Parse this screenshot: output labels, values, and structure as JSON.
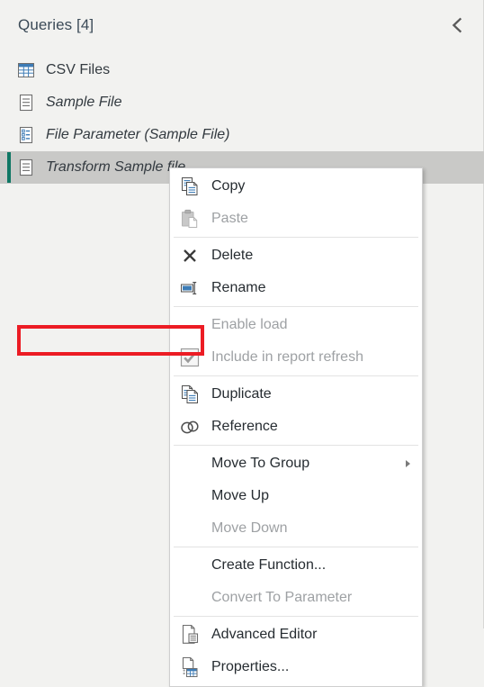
{
  "panel": {
    "title": "Queries [4]",
    "collapse_icon": "chevron-left-icon",
    "accent_color": "#0f7764",
    "selected_row_bg": "#c9c9c7",
    "background": "#f2f2f0"
  },
  "queries": [
    {
      "label": "CSV Files",
      "icon": "table-icon",
      "italic": false,
      "selected": false
    },
    {
      "label": "Sample File",
      "icon": "document-icon",
      "italic": true,
      "selected": false
    },
    {
      "label": "File Parameter (Sample File)",
      "icon": "parameter-icon",
      "italic": true,
      "selected": false
    },
    {
      "label": "Transform Sample file",
      "icon": "document-icon",
      "italic": true,
      "selected": true
    }
  ],
  "context_menu": {
    "groups": [
      {
        "items": [
          {
            "label": "Copy",
            "icon": "copy-icon",
            "disabled": false,
            "submenu": false,
            "highlighted": false
          },
          {
            "label": "Paste",
            "icon": "paste-icon",
            "disabled": true,
            "submenu": false,
            "highlighted": false
          }
        ]
      },
      {
        "items": [
          {
            "label": "Delete",
            "icon": "delete-x-icon",
            "disabled": false,
            "submenu": false,
            "highlighted": false
          },
          {
            "label": "Rename",
            "icon": "rename-icon",
            "disabled": false,
            "submenu": false,
            "highlighted": false
          }
        ]
      },
      {
        "items": [
          {
            "label": "Enable load",
            "icon": "none",
            "disabled": true,
            "submenu": false,
            "highlighted": false
          },
          {
            "label": "Include in report refresh",
            "icon": "checkbox-checked-icon",
            "disabled": true,
            "submenu": false,
            "highlighted": false
          }
        ]
      },
      {
        "items": [
          {
            "label": "Duplicate",
            "icon": "duplicate-icon",
            "disabled": false,
            "submenu": false,
            "highlighted": false
          },
          {
            "label": "Reference",
            "icon": "reference-link-icon",
            "disabled": false,
            "submenu": false,
            "highlighted": false
          }
        ]
      },
      {
        "items": [
          {
            "label": "Move To Group",
            "icon": "none",
            "disabled": false,
            "submenu": true,
            "highlighted": false
          },
          {
            "label": "Move Up",
            "icon": "none",
            "disabled": false,
            "submenu": false,
            "highlighted": false
          },
          {
            "label": "Move Down",
            "icon": "none",
            "disabled": true,
            "submenu": false,
            "highlighted": false
          }
        ]
      },
      {
        "items": [
          {
            "label": "Create Function...",
            "icon": "none",
            "disabled": false,
            "submenu": false,
            "highlighted": true
          },
          {
            "label": "Convert To Parameter",
            "icon": "none",
            "disabled": true,
            "submenu": false,
            "highlighted": false
          }
        ]
      },
      {
        "items": [
          {
            "label": "Advanced Editor",
            "icon": "advanced-editor-icon",
            "disabled": false,
            "submenu": false,
            "highlighted": false
          },
          {
            "label": "Properties...",
            "icon": "properties-icon",
            "disabled": false,
            "submenu": false,
            "highlighted": false
          }
        ]
      }
    ],
    "highlight_color": "#ec1c24"
  }
}
